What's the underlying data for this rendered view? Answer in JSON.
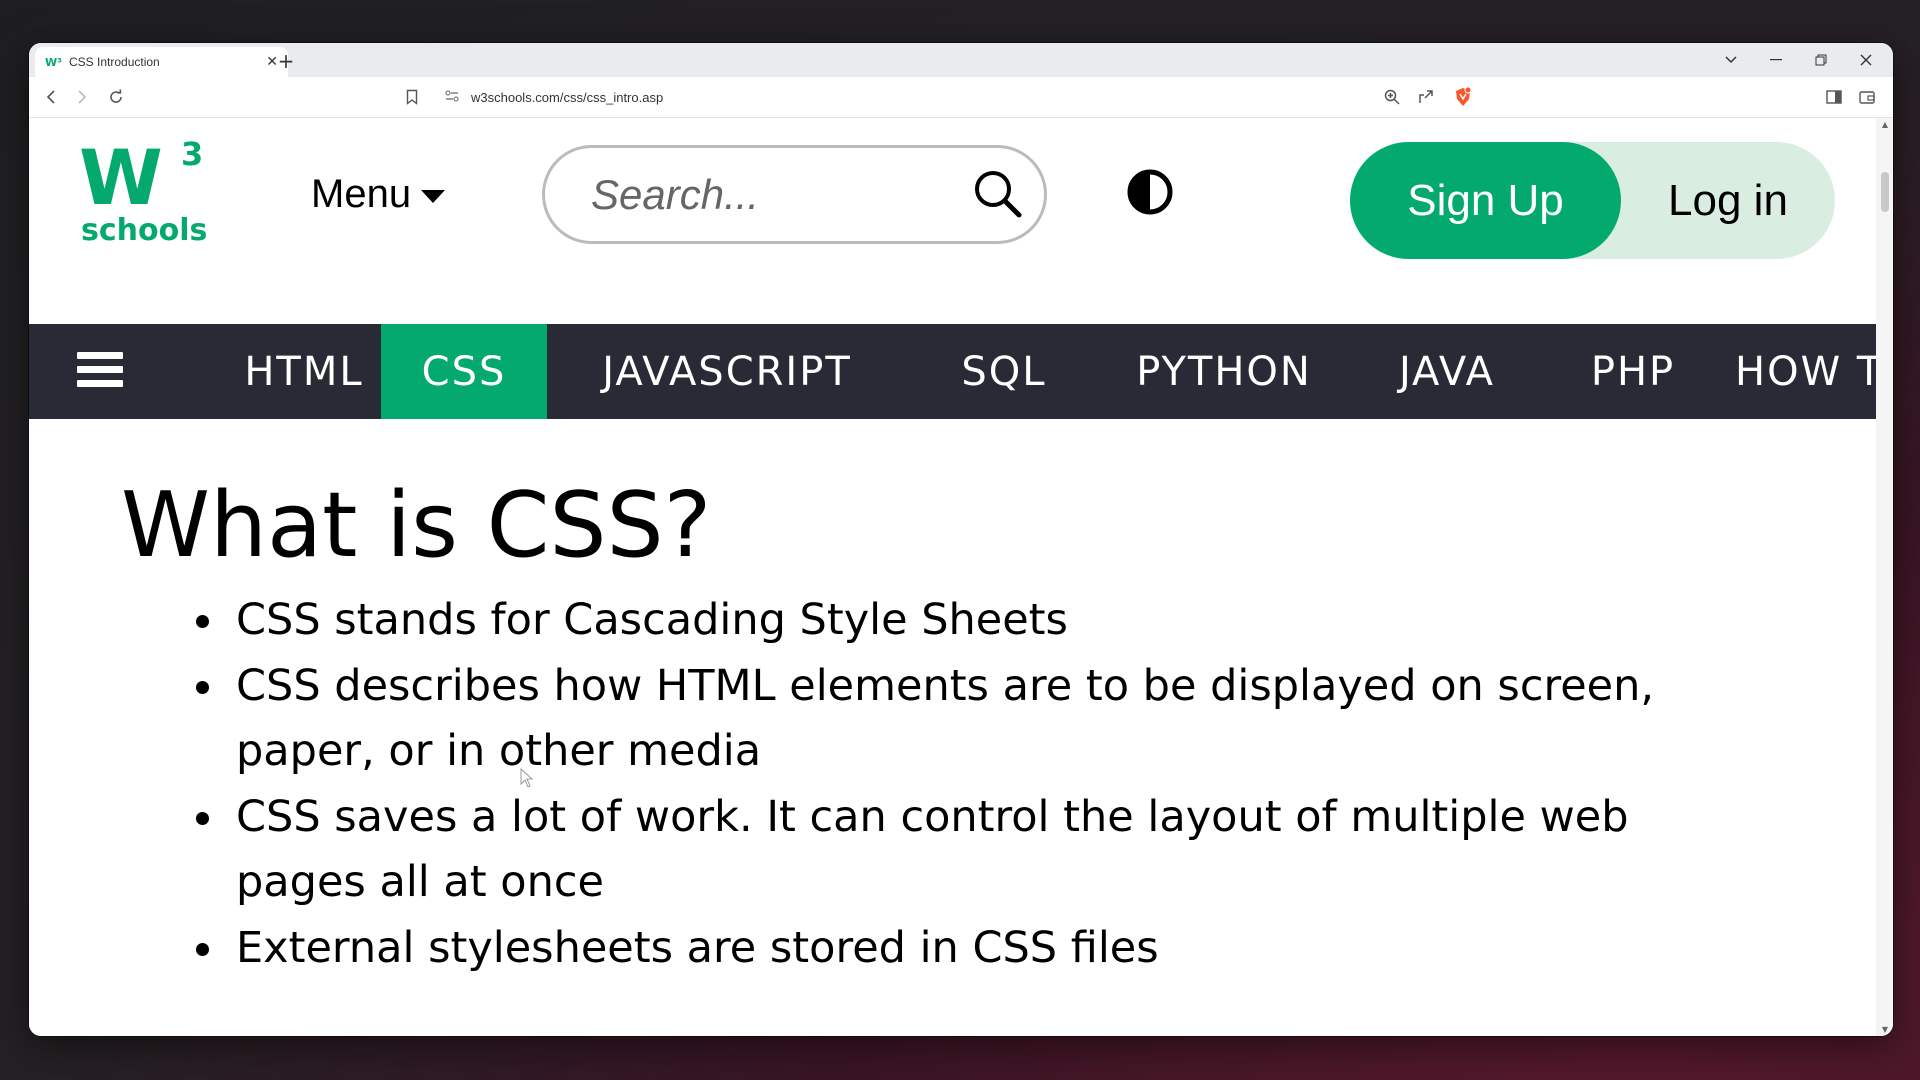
{
  "browser": {
    "tab_title": "CSS Introduction",
    "tab_favicon": "W³",
    "tab_close": "✕",
    "new_tab": "+",
    "url": "w3schools.com/css/css_intro.asp"
  },
  "header": {
    "logo_mark": "W",
    "logo_sup": "3",
    "logo_text": "schools",
    "menu_label": "Menu",
    "search_placeholder": "Search...",
    "signup_label": "Sign Up",
    "login_label": "Log in"
  },
  "topnav": {
    "items": [
      {
        "label": "HTML",
        "active": false
      },
      {
        "label": "CSS",
        "active": true
      },
      {
        "label": "JAVASCRIPT",
        "active": false
      },
      {
        "label": "SQL",
        "active": false
      },
      {
        "label": "PYTHON",
        "active": false
      },
      {
        "label": "JAVA",
        "active": false
      },
      {
        "label": "PHP",
        "active": false
      },
      {
        "label": "HOW T",
        "active": false
      }
    ]
  },
  "content": {
    "heading": "What is CSS?",
    "bullets": [
      "CSS stands for Cascading Style Sheets",
      "CSS describes how HTML elements are to be displayed on screen, paper, or in other media",
      "CSS saves a lot of work. It can control the layout of multiple web pages all at once",
      "External stylesheets are stored in CSS files"
    ]
  },
  "colors": {
    "brand_green": "#04aa6d",
    "nav_dark": "#282a35",
    "login_bg": "#d9eee1"
  }
}
